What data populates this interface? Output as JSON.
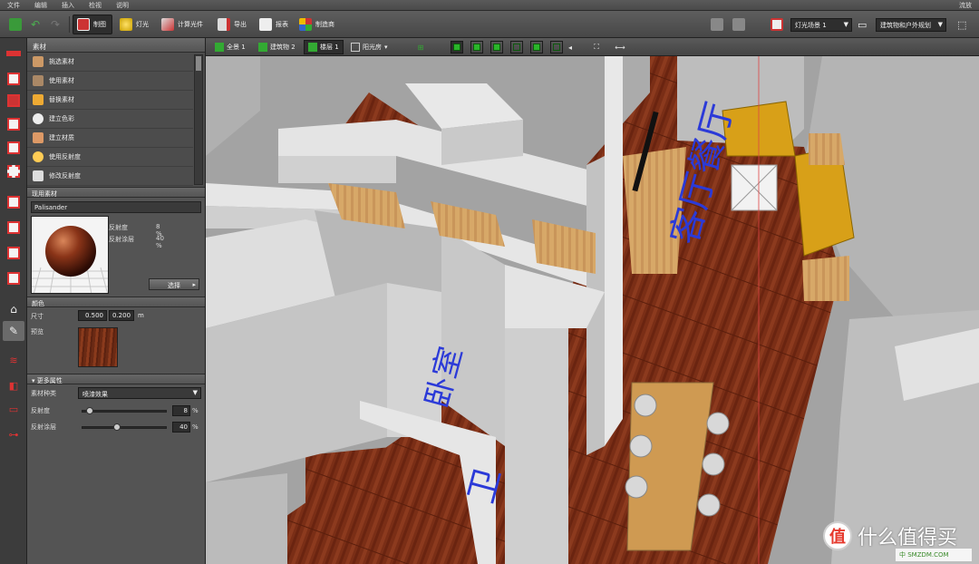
{
  "menu": {
    "items": [
      "文件",
      "编辑",
      "插入",
      "检视",
      "说明"
    ],
    "right": "流放"
  },
  "toolbar": {
    "draw": "制图",
    "light": "灯光",
    "calc_light": "计算光件",
    "export": "导出",
    "report": "报表",
    "manufacturer": "制造商",
    "light_scene": "灯光场景 1",
    "plan": "建筑物和户外规划"
  },
  "panel": {
    "title": "素材",
    "materials": [
      "挑选素材",
      "使用素材",
      "替换素材",
      "建立色彩",
      "建立材质",
      "使用反射度",
      "修改反射度"
    ],
    "current_title": "现用素材",
    "current_name": "Palisander",
    "reflect_label": "反射度",
    "reflect_value": "8 %",
    "coat_label": "反射涂层",
    "coat_value": "40 %",
    "select_btn": "选择",
    "color_title": "颜色",
    "size_label": "尺寸",
    "size_w": "0.500",
    "size_h": "0.200",
    "size_unit": "m",
    "preview_label": "预览",
    "more_title": "更多属性",
    "kind_label": "素材种类",
    "kind_value": "喷漆效果",
    "reflect2_label": "反射度",
    "reflect2_value": "8",
    "coat2_label": "反射涂层",
    "coat2_value": "40",
    "percent": "%",
    "reflect_level": 0.08,
    "coat_level": 0.4
  },
  "viewbar": {
    "tabs": [
      "全景 1",
      "建筑物 2",
      "楼层 1",
      "阳光房"
    ]
  },
  "viewport": {
    "labels": [
      "客厅餐厅",
      "卧室",
      "卫"
    ]
  },
  "watermark": {
    "logo": "值",
    "text": "什么值得买",
    "small": "中 SMZDM.COM"
  }
}
